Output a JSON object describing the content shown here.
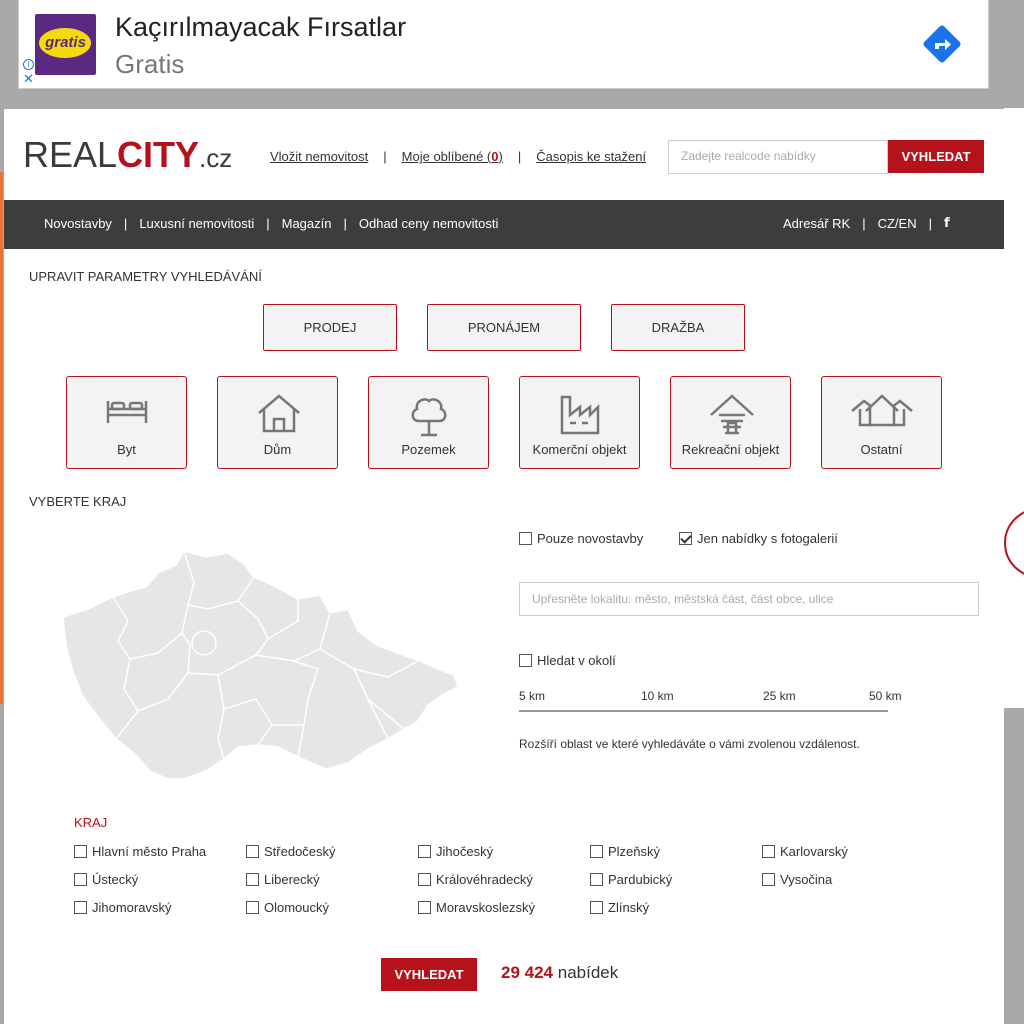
{
  "ad": {
    "logo_text": "gratis",
    "title": "Kaçırılmayacak Fırsatlar",
    "subtitle": "Gratis",
    "info_icon": "info-icon",
    "close_icon": "close-icon",
    "cta_icon": "directions-arrow-icon",
    "brand_color": "#5a2a82",
    "cta_color": "#1a73e8"
  },
  "header": {
    "logo_real": "REAL",
    "logo_city": "CITY",
    "logo_cz": ".cz",
    "links": {
      "add_property": "Vložit nemovitost",
      "favorites_label": "Moje oblíbené (",
      "favorites_count": "0",
      "favorites_close": ")",
      "magazine": "Časopis ke stažení"
    },
    "search_placeholder": "Zadejte realcode nabídky",
    "search_button": "VYHLEDAT"
  },
  "nav": {
    "items": [
      "Novostavby",
      "Luxusní nemovitosti",
      "Magazín",
      "Odhad ceny nemovitosti"
    ],
    "right": [
      "Adresář RK",
      "CZ/EN"
    ],
    "facebook_icon": "facebook-icon",
    "separator": "|"
  },
  "search": {
    "params_title": "UPRAVIT PARAMETRY VYHLEDÁVÁNÍ",
    "transaction_types": [
      "PRODEJ",
      "PRONÁJEM",
      "DRAŽBA"
    ],
    "property_types": [
      {
        "label": "Byt",
        "icon": "bed-icon"
      },
      {
        "label": "Dům",
        "icon": "house-icon"
      },
      {
        "label": "Pozemek",
        "icon": "tree-icon"
      },
      {
        "label": "Komerční objekt",
        "icon": "factory-icon"
      },
      {
        "label": "Rekreační objekt",
        "icon": "cottage-icon"
      },
      {
        "label": "Ostatní",
        "icon": "houses-icon"
      }
    ],
    "region_title": "VYBERTE KRAJ",
    "only_new": "Pouze novostavby",
    "only_new_checked": false,
    "with_gallery": "Jen nabídky s fotogalerií",
    "with_gallery_checked": true,
    "location_placeholder": "Upřesněte lokalitu: město, městská část, část obce, ulice",
    "nearby": "Hledat v okolí",
    "nearby_checked": false,
    "distances": [
      "5 km",
      "10 km",
      "25 km",
      "50 km"
    ],
    "distance_note": "Rozšíří oblast ve které vyhledáváte o vámi zvolenou vzdálenost.",
    "kraj_title": "KRAJ",
    "regions": [
      "Hlavní město Praha",
      "Středočeský",
      "Jihočeský",
      "Plzeňský",
      "Karlovarský",
      "Ústecký",
      "Liberecký",
      "Královéhradecký",
      "Pardubický",
      "Vysočina",
      "Jihomoravský",
      "Olomoucký",
      "Moravskoslezský",
      "Zlínský"
    ],
    "submit": "VYHLEDAT",
    "count": "29 424",
    "count_label": "nabídek",
    "accent_color": "#b5121b"
  }
}
